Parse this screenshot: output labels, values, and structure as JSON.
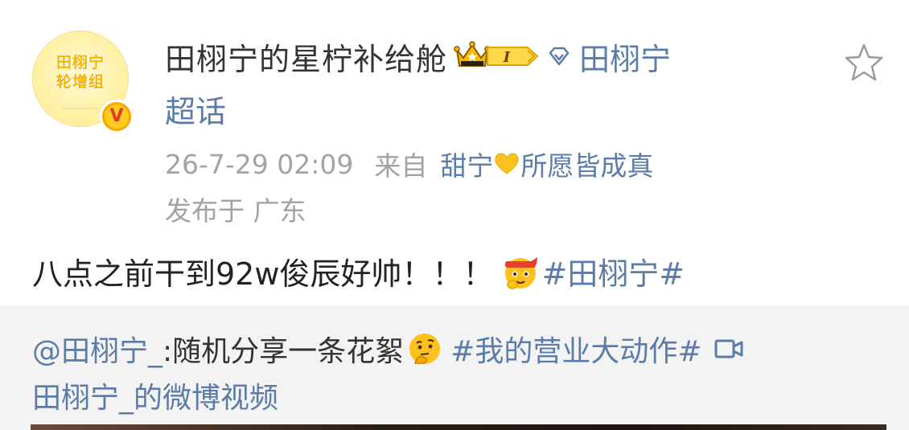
{
  "avatar": {
    "text_line1": "田栩宁",
    "text_line2": "轮增组",
    "verified_mark": "V",
    "colors": {
      "background": "#fff1a8",
      "text": "#f5b400",
      "badge": "#ffcc1e"
    }
  },
  "header": {
    "username": "田栩宁的星柠补给舱",
    "level_badge": "I",
    "supertopic_name": "田栩宁",
    "supertopic_suffix": "超话",
    "icons": {
      "crown": "crown-icon",
      "diamond": "diamond-icon",
      "star": "star-icon"
    }
  },
  "meta": {
    "timestamp": "26-7-29 02:09",
    "from_label": "来自",
    "source_prefix": "甜宁",
    "source_suffix": "所愿皆成真",
    "location": "发布于 广东",
    "icons": {
      "heart": "yellow-heart-icon"
    }
  },
  "post": {
    "text": "八点之前干到92w俊辰好帅！！！",
    "hashtag": "#田栩宁#",
    "icons": {
      "emoji": "headband-face-emoji"
    }
  },
  "repost": {
    "mention": "@田栩宁_",
    "text": ":随机分享一条花絮",
    "hashtag": "#我的营业大动作#",
    "video_link": "田栩宁_的微博视频",
    "icons": {
      "thinking": "thinking-face-emoji",
      "video": "video-camera-icon"
    }
  },
  "colors": {
    "link": "#5b7ca8",
    "text": "#333333",
    "muted": "#a3a3a3",
    "repost_bg": "#f3f3f3"
  }
}
